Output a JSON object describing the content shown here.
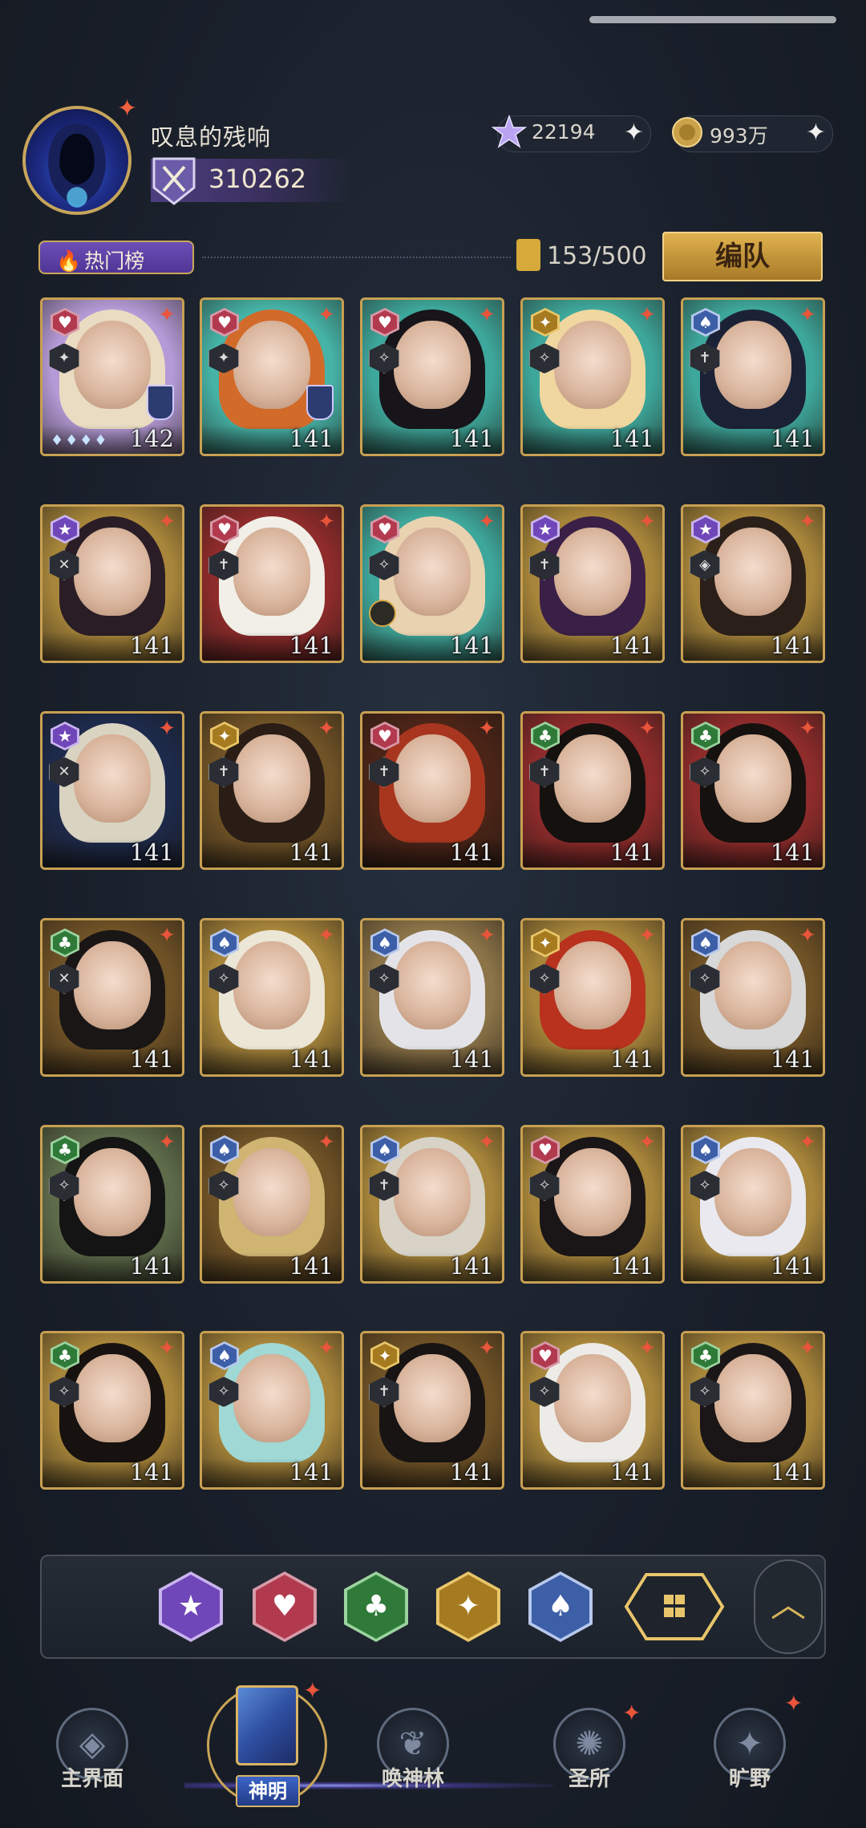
{
  "profile": {
    "name": "叹息的残响",
    "rank_value": "310262"
  },
  "currencies": [
    {
      "icon": "star-crystal-icon",
      "value": "22194",
      "plus": "+"
    },
    {
      "icon": "gold-coin-icon",
      "value": "993万",
      "plus": "+"
    }
  ],
  "toolbar": {
    "hot_label": "热门榜",
    "collection_count": "153/500",
    "team_button": "编队"
  },
  "suits": {
    "heart": {
      "symbol": "♥",
      "color": "#b23a4f",
      "rim": "#d79aa8"
    },
    "diamond": {
      "symbol": "✦",
      "color": "#a67a1f",
      "rim": "#e9c66a"
    },
    "spade": {
      "symbol": "♠",
      "color": "#3d5fa8",
      "rim": "#b7c8ec"
    },
    "star": {
      "symbol": "★",
      "color": "#7047b8",
      "rim": "#c9b4ef"
    },
    "club": {
      "symbol": "♣",
      "color": "#2f7a38",
      "rim": "#9bd39f"
    }
  },
  "cards": [
    {
      "suit": "heart",
      "role": "✦",
      "level": "142",
      "bg": "#b49ad6",
      "hair": "#e9dcc2",
      "shield": true,
      "diamonds": "♦♦♦♦"
    },
    {
      "suit": "heart",
      "role": "✦",
      "level": "141",
      "bg": "#46b3a7",
      "hair": "#d26a2a",
      "shield": true
    },
    {
      "suit": "heart",
      "role": "✧",
      "level": "141",
      "bg": "#3ea79b",
      "hair": "#18151a"
    },
    {
      "suit": "diamond",
      "role": "✧",
      "level": "141",
      "bg": "#3ea79b",
      "hair": "#f0d7a0"
    },
    {
      "suit": "spade",
      "role": "✝",
      "level": "141",
      "bg": "#3ea79b",
      "hair": "#1c2236"
    },
    {
      "suit": "star",
      "role": "✕",
      "level": "141",
      "bg": "#a7853a",
      "hair": "#2a1d26"
    },
    {
      "suit": "heart",
      "role": "✝",
      "level": "141",
      "bg": "#8e2b2b",
      "hair": "#f1efe8"
    },
    {
      "suit": "heart",
      "role": "✧",
      "level": "141",
      "bg": "#3ea79b",
      "hair": "#e9d2b0",
      "clock": true
    },
    {
      "suit": "star",
      "role": "✝",
      "level": "141",
      "bg": "#a7853a",
      "hair": "#3a1f46"
    },
    {
      "suit": "star",
      "role": "◈",
      "level": "141",
      "bg": "#a7853a",
      "hair": "#2b1f19"
    },
    {
      "suit": "star",
      "role": "✕",
      "level": "141",
      "bg": "#1d2a4b",
      "hair": "#d9d3c2"
    },
    {
      "suit": "diamond",
      "role": "✝",
      "level": "141",
      "bg": "#6f5226",
      "hair": "#2a1d16"
    },
    {
      "suit": "heart",
      "role": "✝",
      "level": "141",
      "bg": "#4b2417",
      "hair": "#a8361f"
    },
    {
      "suit": "club",
      "role": "✝",
      "level": "141",
      "bg": "#8e2b2b",
      "hair": "#14110f"
    },
    {
      "suit": "club",
      "role": "✧",
      "level": "141",
      "bg": "#8e2b2b",
      "hair": "#15110f"
    },
    {
      "suit": "club",
      "role": "✕",
      "level": "141",
      "bg": "#6f5226",
      "hair": "#1a1616"
    },
    {
      "suit": "spade",
      "role": "✧",
      "level": "141",
      "bg": "#a7853a",
      "hair": "#ece6d6"
    },
    {
      "suit": "spade",
      "role": "✧",
      "level": "141",
      "bg": "#8c7448",
      "hair": "#e4e4e8"
    },
    {
      "suit": "diamond",
      "role": "✧",
      "level": "141",
      "bg": "#a7853a",
      "hair": "#b8321e"
    },
    {
      "suit": "spade",
      "role": "✧",
      "level": "141",
      "bg": "#6f5226",
      "hair": "#d8d8d8"
    },
    {
      "suit": "club",
      "role": "✧",
      "level": "141",
      "bg": "#5d6b4a",
      "hair": "#141414"
    },
    {
      "suit": "spade",
      "role": "✧",
      "level": "141",
      "bg": "#6f5226",
      "hair": "#cfb472"
    },
    {
      "suit": "spade",
      "role": "✝",
      "level": "141",
      "bg": "#a7853a",
      "hair": "#d8d3c6"
    },
    {
      "suit": "heart",
      "role": "✧",
      "level": "141",
      "bg": "#a7853a",
      "hair": "#1a1517"
    },
    {
      "suit": "spade",
      "role": "✧",
      "level": "141",
      "bg": "#a7853a",
      "hair": "#e9e9ef"
    },
    {
      "suit": "club",
      "role": "✧",
      "level": "141",
      "bg": "#a7853a",
      "hair": "#17120f"
    },
    {
      "suit": "spade",
      "role": "✧",
      "level": "141",
      "bg": "#a7853a",
      "hair": "#9fd8d4"
    },
    {
      "suit": "diamond",
      "role": "✝",
      "level": "141",
      "bg": "#6f5226",
      "hair": "#181413"
    },
    {
      "suit": "heart",
      "role": "✧",
      "level": "141",
      "bg": "#a7853a",
      "hair": "#ecebe7"
    },
    {
      "suit": "club",
      "role": "✧",
      "level": "141",
      "bg": "#a7853a",
      "hair": "#1a1516"
    }
  ],
  "filters": [
    {
      "suit": "star",
      "icon": "star-suit-filter-icon"
    },
    {
      "suit": "heart",
      "icon": "heart-suit-filter-icon"
    },
    {
      "suit": "club",
      "icon": "club-suit-filter-icon"
    },
    {
      "suit": "diamond",
      "icon": "diamond-suit-filter-icon"
    },
    {
      "suit": "spade",
      "icon": "spade-suit-filter-icon"
    }
  ],
  "nav": [
    {
      "label": "主界面",
      "icon": "home-emblem-icon",
      "glyph": "◈"
    },
    {
      "label": "神明",
      "icon": "card-book-icon",
      "active": true
    },
    {
      "label": "唤神林",
      "icon": "tree-emblem-icon",
      "glyph": "❦"
    },
    {
      "label": "圣所",
      "icon": "sanctuary-emblem-icon",
      "glyph": "✺"
    },
    {
      "label": "旷野",
      "icon": "compass-star-icon",
      "glyph": "✦"
    }
  ],
  "colors": {
    "gold": "#c8a052",
    "accent_red": "#e8553b",
    "purple": "#6d4fb7"
  }
}
